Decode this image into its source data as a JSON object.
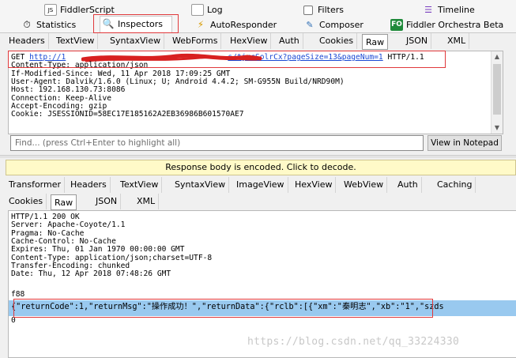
{
  "top_tabs": {
    "row1": [
      {
        "label": "FiddlerScript",
        "icon": "js-file-icon"
      },
      {
        "label": "Log",
        "icon": "log-file-icon"
      },
      {
        "label": "Filters",
        "icon": "filter-checkbox-icon"
      },
      {
        "label": "Timeline",
        "icon": "timeline-icon"
      }
    ],
    "row2": [
      {
        "label": "Statistics",
        "icon": "stopwatch-icon"
      },
      {
        "label": "Inspectors",
        "icon": "magnifier-icon",
        "active": true
      },
      {
        "label": "AutoResponder",
        "icon": "lightning-icon"
      },
      {
        "label": "Composer",
        "icon": "pencil-icon"
      },
      {
        "label": "Fiddler Orchestra Beta",
        "icon": "fo-icon",
        "icon_text": "FO"
      }
    ]
  },
  "request": {
    "tabs": [
      "Headers",
      "TextView",
      "SyntaxView",
      "WebForms",
      "HexView",
      "Auth",
      "Cookies",
      "Raw",
      "JSON",
      "XML"
    ],
    "selected_tab": "Raw",
    "method": "GET ",
    "url_prefix": "http://1",
    "url_suffix": "s/tjrcSolrCx?pageSize=13&pageNum=1",
    "protocol": " HTTP/1.1",
    "lines": [
      "Content-Type: application/json",
      "If-Modified-Since: Wed, 11 Apr 2018 17:09:25 GMT",
      "User-Agent: Dalvik/1.6.0 (Linux; U; Android 4.4.2; SM-G955N Build/NRD90M)",
      "Host: 192.168.130.73:8086",
      "Connection: Keep-Alive",
      "Accept-Encoding: gzip",
      "Cookie: JSESSIONID=58EC17E185162A2EB36986B601570AE7"
    ],
    "find_placeholder": "Find... (press Ctrl+Enter to highlight all)",
    "view_in_notepad": "View in Notepad"
  },
  "notice": "Response body is encoded. Click to decode.",
  "response": {
    "tabs_row1": [
      "Transformer",
      "Headers",
      "TextView",
      "SyntaxView",
      "ImageView",
      "HexView",
      "WebView",
      "Auth",
      "Caching"
    ],
    "tabs_row2": [
      "Cookies",
      "Raw",
      "JSON",
      "XML"
    ],
    "selected_tab": "Raw",
    "lines": [
      "HTTP/1.1 200 OK",
      "Server: Apache-Coyote/1.1",
      "Pragma: No-Cache",
      "Cache-Control: No-Cache",
      "Expires: Thu, 01 Jan 1970 00:00:00 GMT",
      "Content-Type: application/json;charset=UTF-8",
      "Transfer-Encoding: chunked",
      "Date: Thu, 12 Apr 2018 07:48:26 GMT",
      "",
      "f88"
    ],
    "body_line": "{\"returnCode\":1,\"returnMsg\":\"操作成功！\",\"returnData\":{\"rclb\":[{\"xm\":\"秦明志\",\"xb\":\"1\",\"szds",
    "trailer": "0"
  },
  "watermark": "https://blog.csdn.net/qq_33224330",
  "colors": {
    "highlight_red": "#e0393b",
    "selection_blue": "#99c9ef",
    "link_blue": "#1b49d4",
    "notice_bg": "#fffac8"
  }
}
